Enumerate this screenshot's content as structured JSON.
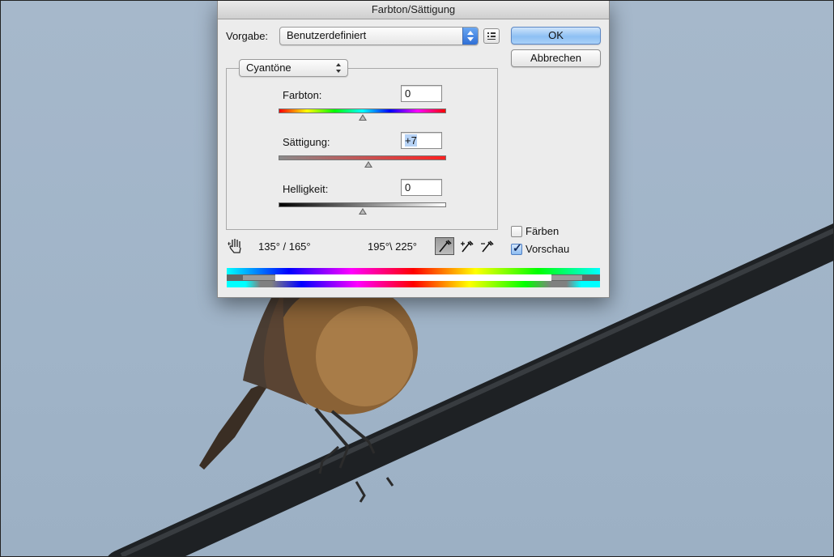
{
  "dialog": {
    "title": "Farbton/Sättigung",
    "preset_label": "Vorgabe:",
    "preset_value": "Benutzerdefiniert",
    "ok_label": "OK",
    "cancel_label": "Abbrechen",
    "channel_value": "Cyantöne",
    "hue": {
      "label": "Farbton:",
      "value": "0",
      "slider_level": 0.5
    },
    "saturation": {
      "label": "Sättigung:",
      "value": "+7",
      "slider_level": 0.535
    },
    "lightness": {
      "label": "Helligkeit:",
      "value": "0",
      "slider_level": 0.5
    },
    "range_left": "135° / 165°",
    "range_right": "195°\\ 225°",
    "colorize": {
      "label": "Färben",
      "checked": false
    },
    "preview": {
      "label": "Vorschau",
      "checked": true
    }
  },
  "icons": {
    "preset_options": "options-list-icon",
    "target_adjust": "hand-target-icon",
    "eyedropper": "eyedropper-icon",
    "eyedropper_add": "eyedropper-plus-icon",
    "eyedropper_subtract": "eyedropper-minus-icon",
    "checkmark": "✓"
  },
  "colors": {
    "accent": "#5c87c4",
    "sky": "#a3b6ca",
    "cable": "#2a2e31",
    "bird_body": "#8a6236"
  }
}
